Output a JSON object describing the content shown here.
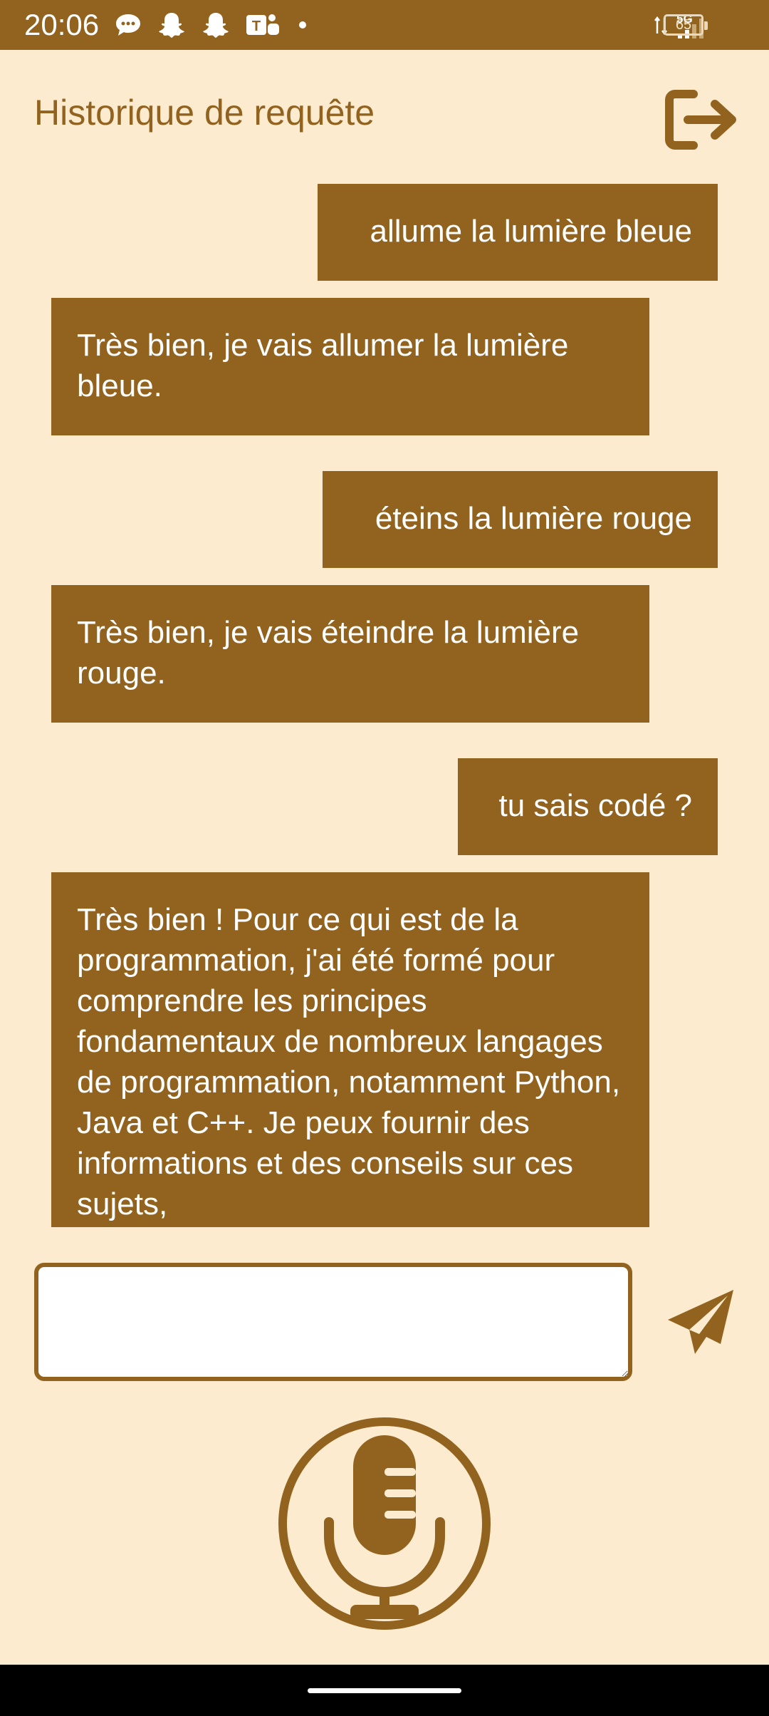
{
  "status_bar": {
    "time": "20:06",
    "battery": "65",
    "network": "5G",
    "notification_icons": [
      "chat-bubble-icon",
      "snapchat-icon",
      "snapchat-icon",
      "teams-icon",
      "more-dot-icon"
    ]
  },
  "header": {
    "title": "Historique de requête",
    "logout_icon": "logout-icon"
  },
  "messages": [
    {
      "sender": "user",
      "text": "allume la lumière bleue"
    },
    {
      "sender": "assistant",
      "text": "Très bien, je vais allumer la lumière bleue."
    },
    {
      "sender": "user",
      "text": "éteins la lumière rouge"
    },
    {
      "sender": "assistant",
      "text": "Très bien, je vais éteindre la lumière rouge."
    },
    {
      "sender": "user",
      "text": "tu sais codé ?"
    },
    {
      "sender": "assistant",
      "text": "Très bien ! Pour ce qui est de la programmation, j'ai été formé pour comprendre les principes fondamentaux de nombreux langages de programmation, notamment Python, Java et C++. Je peux fournir des informations et des conseils sur ces sujets,"
    }
  ],
  "composer": {
    "input_value": "",
    "send_icon": "send-icon",
    "mic_icon": "microphone-icon"
  },
  "colors": {
    "accent": "#92631F",
    "background": "#FDEBCF"
  }
}
